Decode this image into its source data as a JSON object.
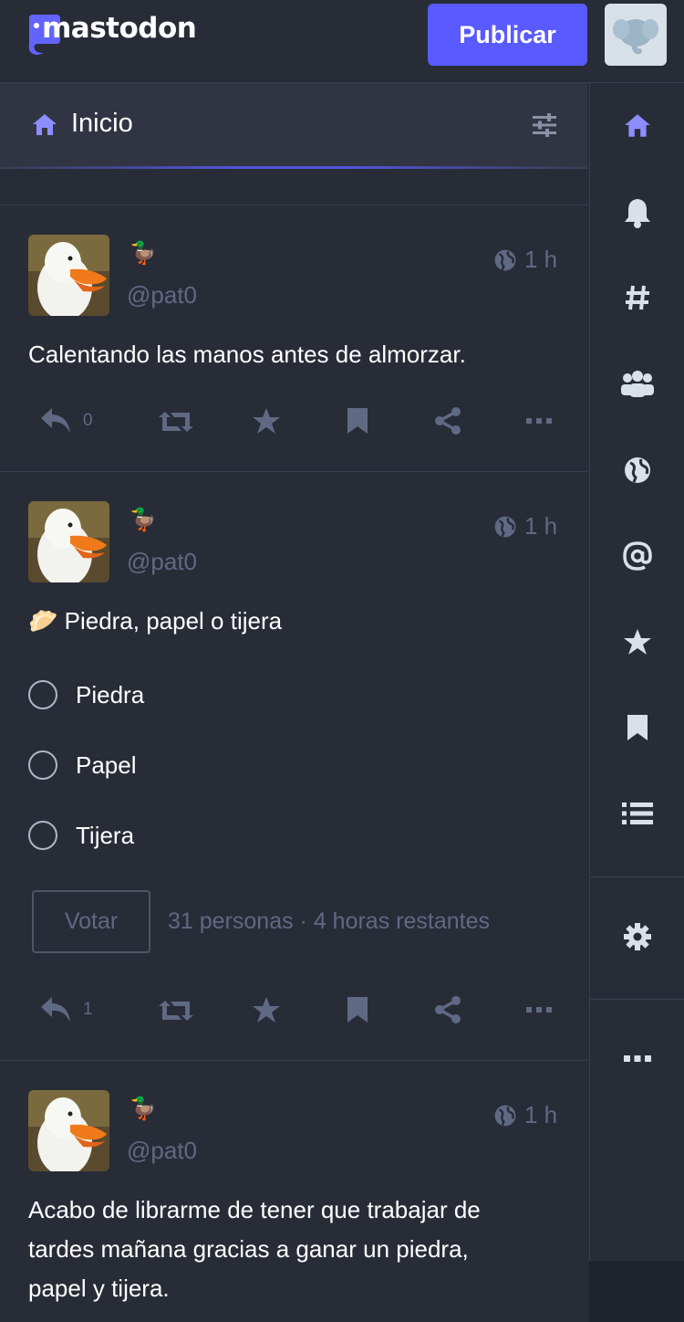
{
  "app": {
    "logo_text": "mastodon",
    "publish_label": "Publicar"
  },
  "column": {
    "title": "Inicio"
  },
  "nav": {
    "items": [
      "home-icon",
      "bell-icon",
      "hashtag-icon",
      "users-icon",
      "globe-icon",
      "at-icon",
      "star-icon",
      "bookmark-icon",
      "list-icon",
      "gear-icon",
      "more-icon"
    ]
  },
  "colors": {
    "accent": "#595aff",
    "background": "#282c37",
    "muted": "#606984",
    "nav_icon": "#d9e1e8",
    "active_nav": "#8c8dff"
  },
  "statuses": [
    {
      "display_emoji": "🦆",
      "handle": "@pat0",
      "time": "1 h",
      "content": "Calentando las manos antes de almorzar.",
      "reply_count": "0"
    },
    {
      "display_emoji": "🦆",
      "handle": "@pat0",
      "time": "1 h",
      "content_emoji": "🥟",
      "content": "Piedra, papel o tijera",
      "poll": {
        "options": [
          "Piedra",
          "Papel",
          "Tijera"
        ],
        "vote_label": "Votar",
        "meta": "31 personas · 4 horas restantes"
      },
      "reply_count": "1"
    },
    {
      "display_emoji": "🦆",
      "handle": "@pat0",
      "time": "1 h",
      "content_lines": [
        "Acabo de librarme de tener que trabajar de",
        "tardes mañana gracias a ganar un piedra,",
        "papel y tijera."
      ]
    }
  ]
}
